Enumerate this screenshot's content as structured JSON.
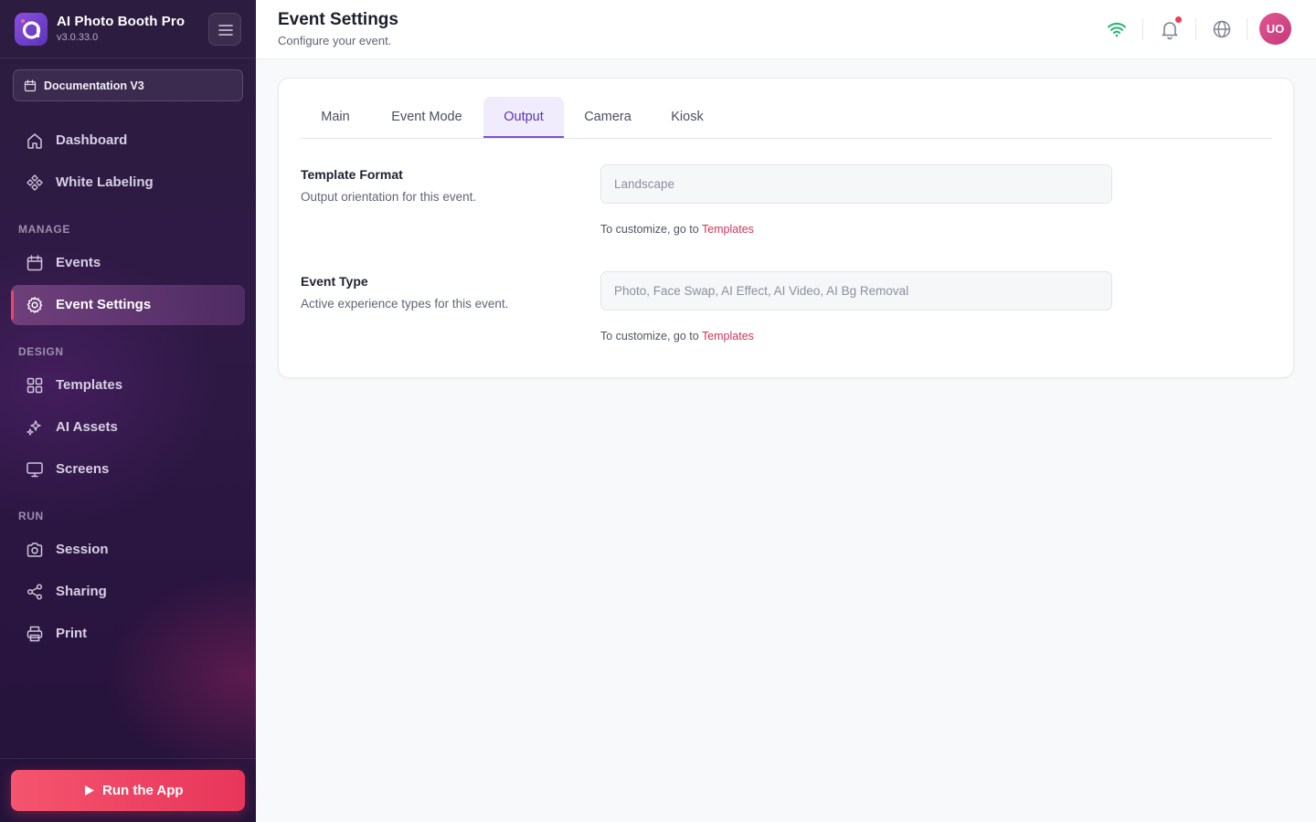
{
  "app": {
    "name": "AI Photo Booth Pro",
    "version": "v3.0.33.0"
  },
  "event_selector": {
    "label": "Documentation V3"
  },
  "nav": {
    "top": [
      {
        "label": "Dashboard",
        "icon": "home-icon"
      },
      {
        "label": "White Labeling",
        "icon": "white-labeling-icon"
      }
    ],
    "manage_label": "MANAGE",
    "manage": [
      {
        "label": "Events",
        "icon": "calendar-icon"
      },
      {
        "label": "Event Settings",
        "icon": "gear-icon",
        "active": true
      }
    ],
    "design_label": "DESIGN",
    "design": [
      {
        "label": "Templates",
        "icon": "grid-icon"
      },
      {
        "label": "AI Assets",
        "icon": "sparkles-icon"
      },
      {
        "label": "Screens",
        "icon": "monitor-icon"
      }
    ],
    "run_label": "RUN",
    "run": [
      {
        "label": "Session",
        "icon": "camera-icon"
      },
      {
        "label": "Sharing",
        "icon": "share-icon"
      },
      {
        "label": "Print",
        "icon": "printer-icon"
      }
    ]
  },
  "run_button": {
    "label": "Run the App"
  },
  "header": {
    "title": "Event Settings",
    "subtitle": "Configure your event.",
    "avatar_initials": "UO",
    "icons": [
      "wifi-icon",
      "bell-icon",
      "globe-icon"
    ]
  },
  "tabs": [
    {
      "label": "Main"
    },
    {
      "label": "Event Mode"
    },
    {
      "label": "Output",
      "active": true
    },
    {
      "label": "Camera"
    },
    {
      "label": "Kiosk"
    }
  ],
  "fields": [
    {
      "label": "Template Format",
      "description": "Output orientation for this event.",
      "placeholder": "Landscape",
      "hint_prefix": "To customize, go to ",
      "hint_link": "Templates"
    },
    {
      "label": "Event Type",
      "description": "Active experience types for this event.",
      "placeholder": "Photo, Face Swap, AI Effect, AI Video, AI Bg Removal",
      "hint_prefix": "To customize, go to ",
      "hint_link": "Templates"
    }
  ],
  "colors": {
    "sidebar_bg": "#2c1c3f",
    "accent_purple": "#5b34b8",
    "accent_red": "#e8365a",
    "link": "#d2365b",
    "wifi_green": "#22b573"
  }
}
